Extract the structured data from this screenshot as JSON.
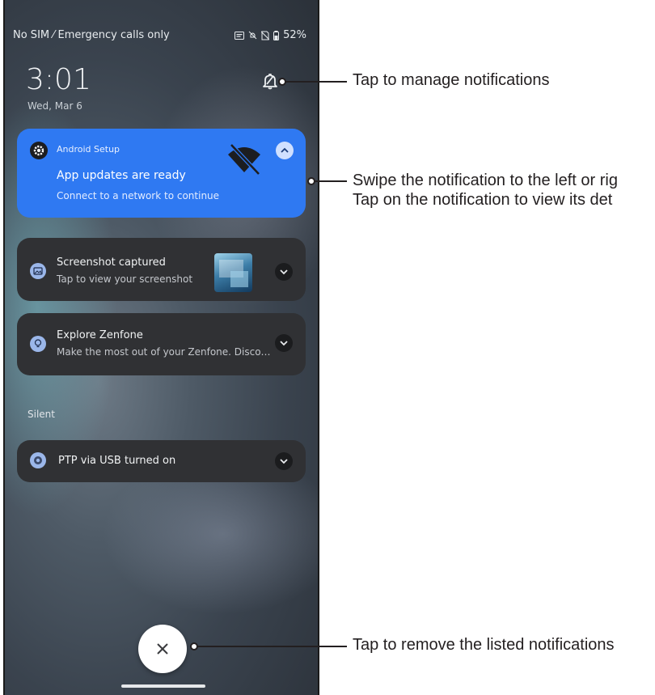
{
  "status_bar": {
    "carrier": "No SIM ⁄ Emergency calls only",
    "battery": "52%"
  },
  "lockscreen": {
    "time": "3:01",
    "date": "Wed, Mar 6"
  },
  "notifications": [
    {
      "app": "Android Setup",
      "title": "App updates are ready",
      "text": "Connect to a network to continue",
      "expanded": true
    },
    {
      "title": "Screenshot captured",
      "text": "Tap to view your screenshot"
    },
    {
      "title": "Explore Zenfone",
      "text": "Make the most out of your Zenfone. Disco…"
    }
  ],
  "silent": {
    "header": "Silent",
    "items": [
      {
        "title": "PTP via USB turned on"
      }
    ]
  },
  "callouts": {
    "manage": "Tap to manage notifications",
    "swipe_line1": "Swipe the notification to the left or rig",
    "swipe_line2": "Tap on the notification to view its det",
    "clear": "Tap to remove the listed notifications"
  },
  "colors": {
    "accent_blue": "#2f79f2",
    "card_dark": "#303134"
  }
}
